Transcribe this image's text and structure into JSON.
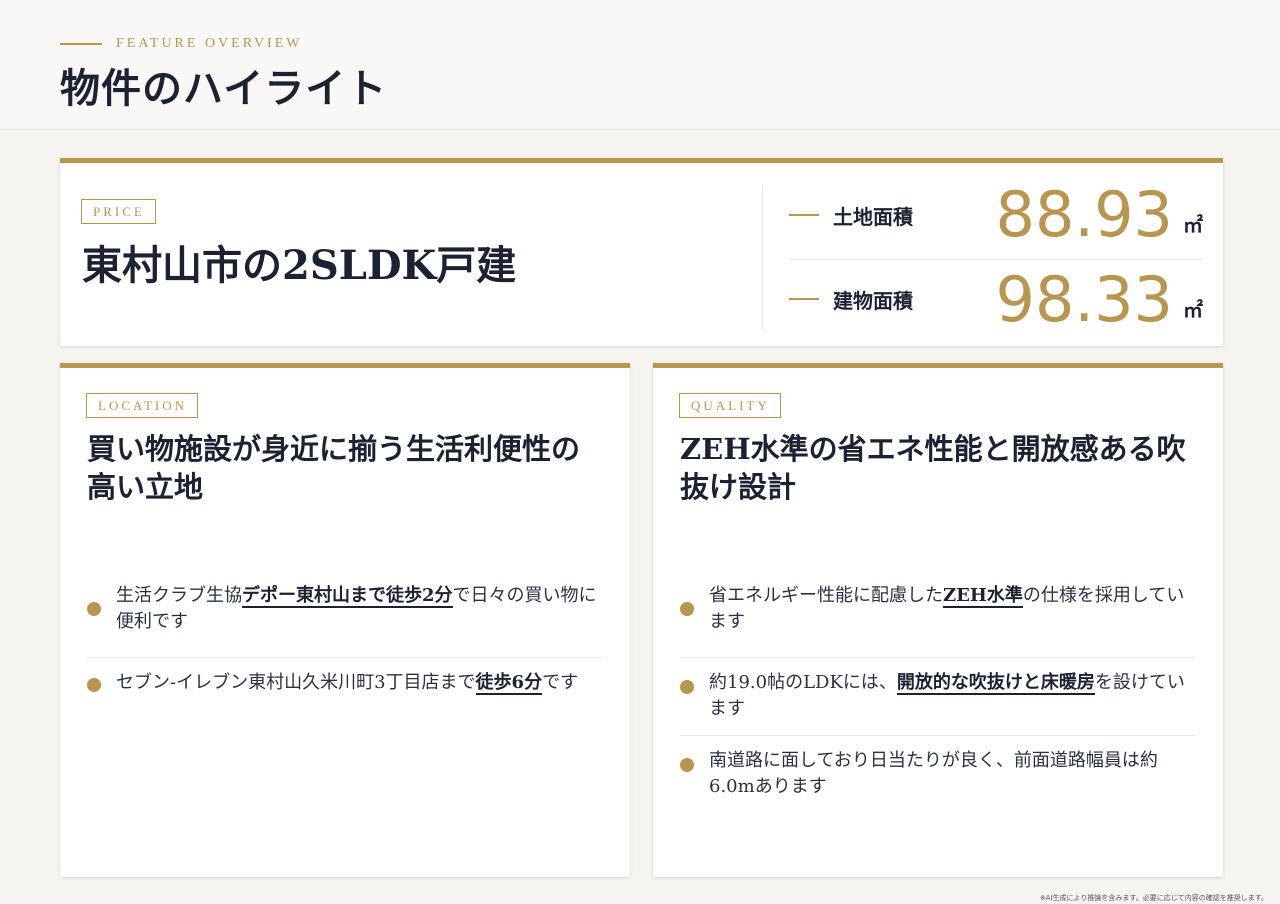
{
  "header": {
    "eyebrow": "FEATURE OVERVIEW",
    "title": "物件のハイライト"
  },
  "price_card": {
    "tag": "PRICE",
    "title": "東村山市の2SLDK戸建",
    "stats": [
      {
        "label": "土地面積",
        "value": "88.93",
        "unit": "㎡"
      },
      {
        "label": "建物面積",
        "value": "98.33",
        "unit": "㎡"
      }
    ]
  },
  "location": {
    "tag": "LOCATION",
    "title": "買い物施設が身近に揃う生活利便性の高い立地",
    "bullets": [
      {
        "pre": "生活クラブ生協",
        "hl": "デポー東村山まで徒歩2分",
        "post": "で日々の買い物に便利です"
      },
      {
        "pre": "セブン-イレブン東村山久米川町3丁目店まで",
        "hl": "徒歩6分",
        "post": "です"
      }
    ]
  },
  "quality": {
    "tag": "QUALITY",
    "title": "ZEH水準の省エネ性能と開放感ある吹抜け設計",
    "bullets": [
      {
        "pre": "省エネルギー性能に配慮した",
        "hl": "ZEH水準",
        "post": "の仕様を採用しています"
      },
      {
        "pre": "約19.0帖のLDKには、",
        "hl": "開放的な吹抜けと床暖房",
        "post": "を設けています"
      },
      {
        "pre": "南道路に面しており日当たりが良く、前面道路幅員は約6.0mあります",
        "hl": "",
        "post": ""
      }
    ]
  },
  "footnote": "※AI生成により推論を含みます。必要に応じて内容の確認を推奨します。",
  "colors": {
    "accent": "#b8964f",
    "text": "#1d2232"
  }
}
